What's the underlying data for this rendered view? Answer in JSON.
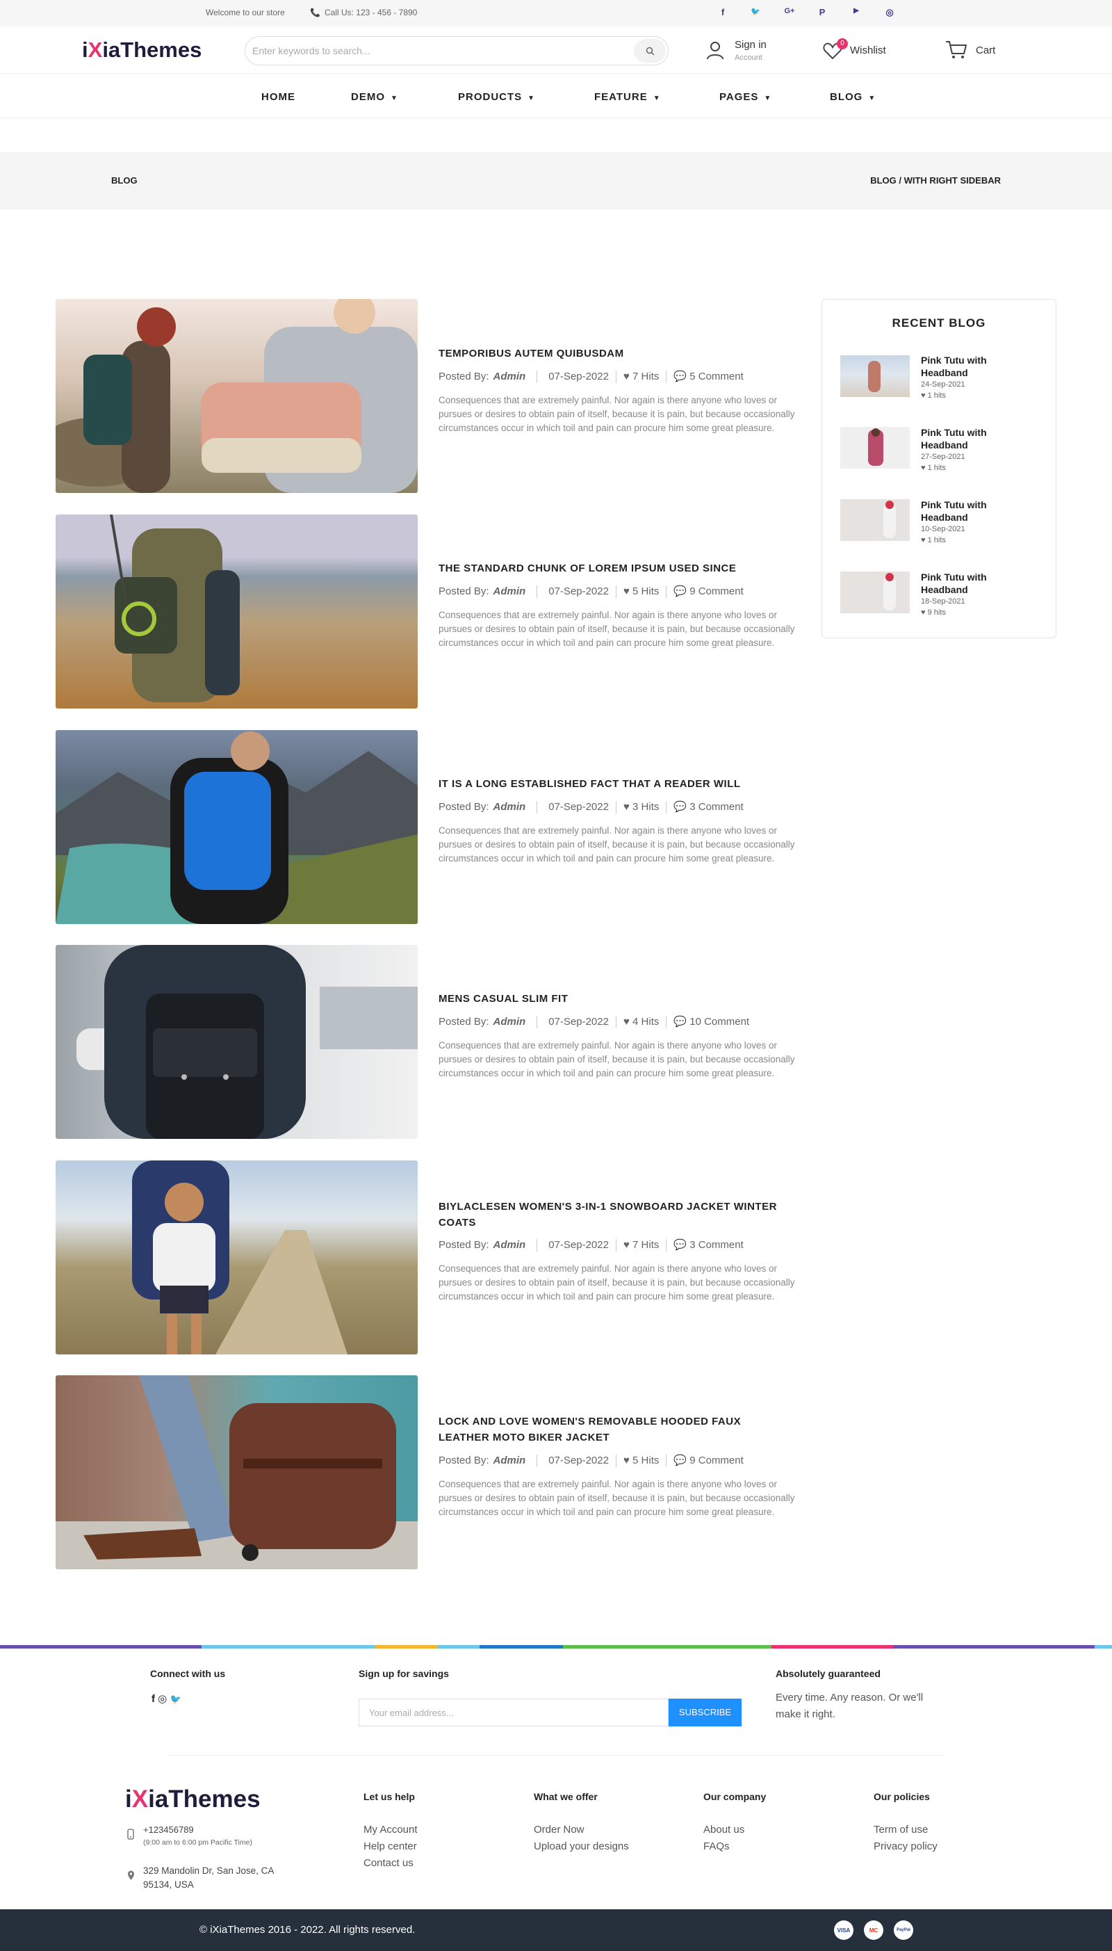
{
  "topbar": {
    "welcome": "Welcome to our store",
    "call": "Call Us: 123 - 456 - 7890",
    "social_icons": [
      "facebook-icon",
      "twitter-icon",
      "google-plus-icon",
      "pinterest-icon",
      "youtube-icon",
      "instagram-icon"
    ],
    "social_glyphs": [
      "f",
      "🐦",
      "G+",
      "P",
      "▶",
      "◎"
    ]
  },
  "header": {
    "logo_i": "i",
    "logo_x": "X",
    "logo_rest": "iaThemes",
    "search_placeholder": "Enter keywords to search...",
    "signin": "Sign in",
    "account": "Account",
    "wishlist": "Wishlist",
    "wishlist_count": "0",
    "cart": "Cart"
  },
  "nav": {
    "items": [
      {
        "label": "HOME",
        "has_dropdown": false
      },
      {
        "label": "DEMO",
        "has_dropdown": true
      },
      {
        "label": "PRODUCTS",
        "has_dropdown": true
      },
      {
        "label": "FEATURE",
        "has_dropdown": true
      },
      {
        "label": "PAGES",
        "has_dropdown": true
      },
      {
        "label": "BLOG",
        "has_dropdown": true
      }
    ]
  },
  "breadcrumb": {
    "page": "BLOG",
    "trail": "BLOG / WITH RIGHT SIDEBAR"
  },
  "posts": [
    {
      "title_line1": "TEMPORIBUS AUTEM QUIBUSDAM",
      "title_line2": "",
      "posted_by": "Posted By:",
      "author": "Admin",
      "date": "07-Sep-2022",
      "hits": "7 Hits",
      "comments": "5 Comment",
      "excerpt": "Consequences that are extremely painful. Nor again is there anyone who loves or pursues or desires to obtain pain of itself, because it is pain, but because occasionally circumstances occur in which toil and pain can procure him some great pleasure.",
      "image": "hikers-with-duffel-bag"
    },
    {
      "title_line1": "THE STANDARD CHUNK OF LOREM IPSUM USED SINCE",
      "title_line2": "",
      "posted_by": "Posted By:",
      "author": "Admin",
      "date": "07-Sep-2022",
      "hits": "5 Hits",
      "comments": "9 Comment",
      "excerpt": "Consequences that are extremely painful. Nor again is there anyone who loves or pursues or desires to obtain pain of itself, because it is pain, but because occasionally circumstances occur in which toil and pain can procure him some great pleasure.",
      "image": "hiker-with-climbing-backpack"
    },
    {
      "title_line1": "IT IS A LONG ESTABLISHED FACT THAT A READER WILL",
      "title_line2": "",
      "posted_by": "Posted By:",
      "author": "Admin",
      "date": "07-Sep-2022",
      "hits": "3 Hits",
      "comments": "3 Comment",
      "excerpt": "Consequences that are extremely painful. Nor again is there anyone who loves or pursues or desires to obtain pain of itself, because it is pain, but because occasionally circumstances occur in which toil and pain can procure him some great pleasure.",
      "image": "hiker-blue-backpack-fjord"
    },
    {
      "title_line1": "MENS CASUAL SLIM FIT",
      "title_line2": "",
      "posted_by": "Posted By:",
      "author": "Admin",
      "date": "07-Sep-2022",
      "hits": "4 Hits",
      "comments": "10 Comment",
      "excerpt": "Consequences that are extremely painful. Nor again is there anyone who loves or pursues or desires to obtain pain of itself, because it is pain, but because occasionally circumstances occur in which toil and pain can procure him some great pleasure.",
      "image": "man-black-leather-backpack"
    },
    {
      "title_line1": "BIYLACLESEN WOMEN'S 3-IN-1 SNOWBOARD JACKET WINTER",
      "title_line2": "COATS",
      "posted_by": "Posted By:",
      "author": "Admin",
      "date": "07-Sep-2022",
      "hits": "7 Hits",
      "comments": "3 Comment",
      "excerpt": "Consequences that are extremely painful. Nor again is there anyone who loves or pursues or desires to obtain pain of itself, because it is pain, but because occasionally circumstances occur in which toil and pain can procure him some great pleasure.",
      "image": "woman-backpacker-dirt-road"
    },
    {
      "title_line1": "LOCK AND LOVE WOMEN'S REMOVABLE HOODED FAUX",
      "title_line2": "LEATHER MOTO BIKER JACKET",
      "posted_by": "Posted By:",
      "author": "Admin",
      "date": "07-Sep-2022",
      "hits": "5 Hits",
      "comments": "9 Comment",
      "excerpt": "Consequences that are extremely painful. Nor again is there anyone who loves or pursues or desires to obtain pain of itself, because it is pain, but because occasionally circumstances occur in which toil and pain can procure him some great pleasure.",
      "image": "brown-leather-rolling-bag"
    }
  ],
  "sidebar": {
    "title": "RECENT BLOG",
    "items": [
      {
        "title_line1": "Pink Tutu with",
        "title_line2": "Headband",
        "date": "24-Sep-2021",
        "hits": "1 hits"
      },
      {
        "title_line1": "Pink Tutu with",
        "title_line2": "Headband",
        "date": "27-Sep-2021",
        "hits": "1 hits"
      },
      {
        "title_line1": "Pink Tutu with",
        "title_line2": "Headband",
        "date": "10-Sep-2021",
        "hits": "1 hits"
      },
      {
        "title_line1": "Pink Tutu with",
        "title_line2": "Headband",
        "date": "18-Sep-2021",
        "hits": "9 hits"
      }
    ]
  },
  "footer": {
    "connect": "Connect with us",
    "social": [
      "f",
      "◎",
      "🐦"
    ],
    "signup": "Sign up for savings",
    "email_placeholder": "Your email address...",
    "subscribe": "SUBSCRIBE",
    "guaranteed": "Absolutely guaranteed",
    "guaranteed_line1": "Every time. Any reason. Or we'll",
    "guaranteed_line2": "make it right.",
    "phone": "+123456789",
    "hours": "(9:00 am to 6:00 pm Pacific Time)",
    "address_line1": "329 Mandolin Dr, San Jose, CA",
    "address_line2": "95134, USA",
    "columns": [
      {
        "heading": "Let us help",
        "links": [
          "My Account",
          "Help center",
          "Contact us"
        ]
      },
      {
        "heading": "What we offer",
        "links": [
          "Order Now",
          "Upload your designs"
        ]
      },
      {
        "heading": "Our company",
        "links": [
          "About us",
          "FAQs"
        ]
      },
      {
        "heading": "Our policies",
        "links": [
          "Term of use",
          "Privacy policy"
        ]
      }
    ],
    "copyright": "© iXiaThemes 2016 - 2022. All rights reserved.",
    "payments": [
      "VISA",
      "MC",
      "PayPal"
    ]
  },
  "colors": {
    "brand": "#e8336f",
    "logo_dark": "#1e1e3c",
    "subscribe": "#1e90ff",
    "footer_bar": "#25303c",
    "social": "#4a3b8f"
  }
}
